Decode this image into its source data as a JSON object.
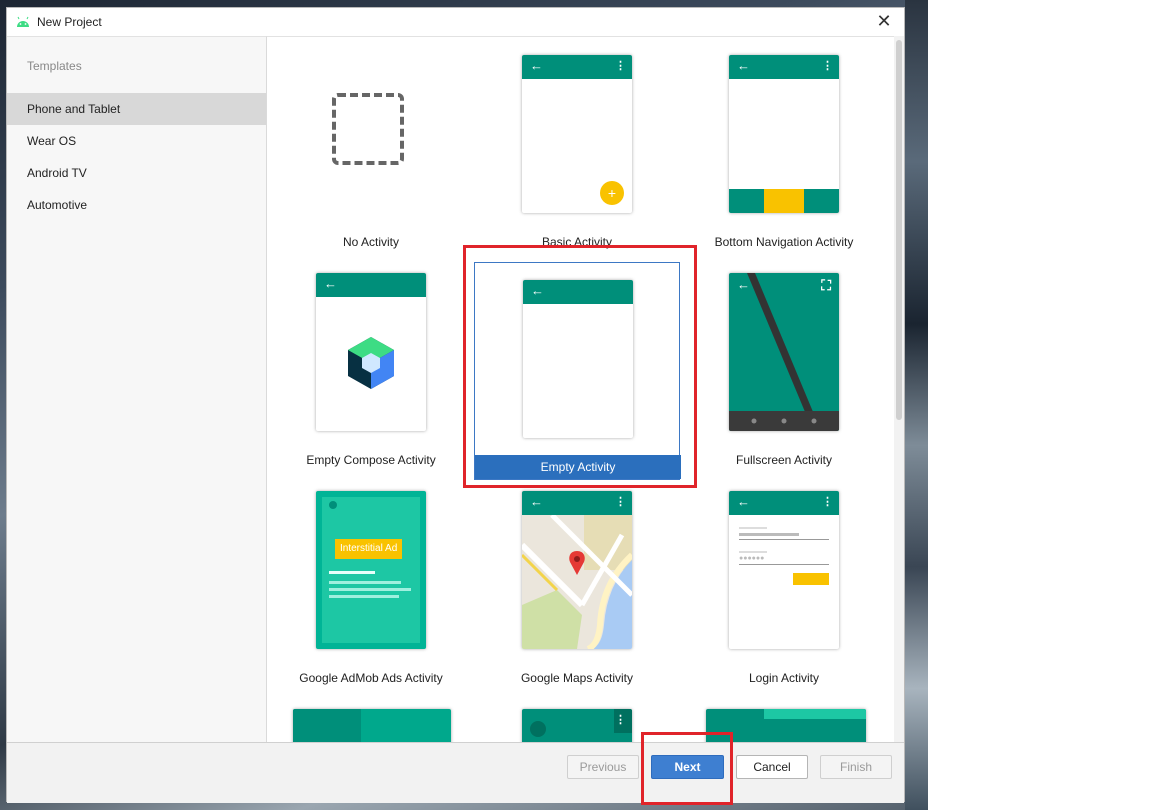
{
  "window": {
    "title": "New Project"
  },
  "sidebar": {
    "header": "Templates",
    "items": [
      {
        "label": "Phone and Tablet",
        "selected": true
      },
      {
        "label": "Wear OS"
      },
      {
        "label": "Android TV"
      },
      {
        "label": "Automotive"
      }
    ]
  },
  "templates": [
    {
      "label": "No Activity"
    },
    {
      "label": "Basic Activity"
    },
    {
      "label": "Bottom Navigation Activity"
    },
    {
      "label": "Empty Compose Activity"
    },
    {
      "label": "Empty Activity",
      "selected": true
    },
    {
      "label": "Fullscreen Activity"
    },
    {
      "label": "Google AdMob Ads Activity",
      "ad_text": "Interstitial Ad"
    },
    {
      "label": "Google Maps Activity"
    },
    {
      "label": "Login Activity"
    }
  ],
  "footer": {
    "previous": "Previous",
    "next": "Next",
    "cancel": "Cancel",
    "finish": "Finish"
  },
  "colors": {
    "teal": "#008f7a",
    "accent": "#f9c200",
    "selection_blue": "#2b6fbd",
    "highlight_red": "#e0242a"
  }
}
